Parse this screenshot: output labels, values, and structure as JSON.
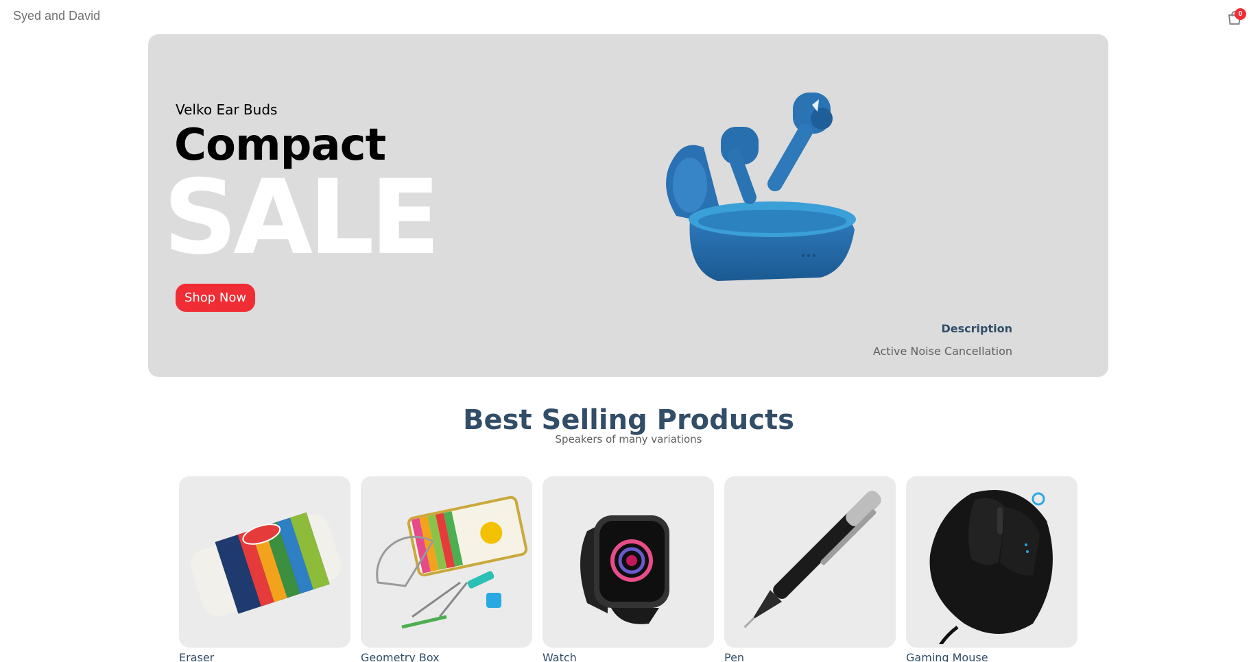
{
  "navbar": {
    "logo": "Syed and David",
    "cart_icon": "shopping-bag-icon",
    "cart_count": "0"
  },
  "hero": {
    "small_text": "Velko Ear Buds",
    "mid_text": "Compact",
    "large_text": "SALE",
    "image": "earbuds-case",
    "button_label": "Shop Now",
    "description_title": "Description",
    "description_text": "Active Noise Cancellation"
  },
  "best_selling": {
    "title": "Best Selling Products",
    "subtitle": "Speakers of many variations"
  },
  "products": [
    {
      "name": "Eraser",
      "image": "eraser"
    },
    {
      "name": "Geometry Box",
      "image": "geometry-box"
    },
    {
      "name": "Watch",
      "image": "smartwatch"
    },
    {
      "name": "Pen",
      "image": "pen"
    },
    {
      "name": "Gaming Mouse",
      "image": "gaming-mouse"
    }
  ],
  "colors": {
    "accent": "#f02d34",
    "heading": "#324d67",
    "hero_bg": "#dcdcdc",
    "card_bg": "#ebebeb"
  }
}
